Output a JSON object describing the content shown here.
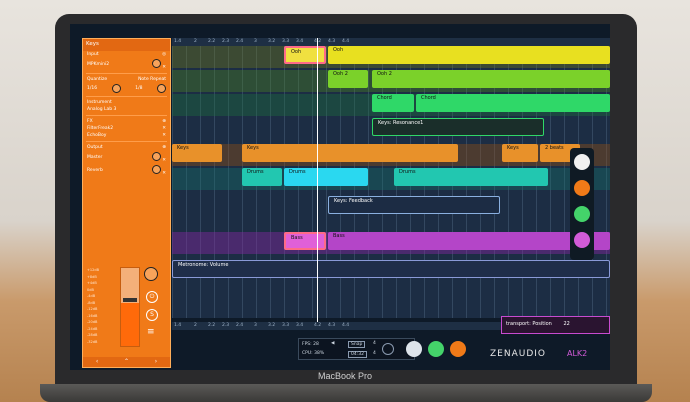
{
  "laptop_brand": "MacBook Pro",
  "panel": {
    "title": "Keys",
    "input_label": "Input",
    "input_device": "MPKmini2",
    "quantize_label": "Quantize",
    "note_repeat_label": "Note Repeat",
    "quantize_value": "1/16",
    "note_repeat_value": "1/8",
    "instrument_label": "Instrument",
    "instrument_value": "Analog Lab 3",
    "fx_label": "FX",
    "fx_items": [
      "FilterFreak2",
      "EchoBoy"
    ],
    "output_label": "Output",
    "output_items": [
      "Master",
      "Reverb"
    ],
    "db_scale": [
      "+12dB",
      "+8dB",
      "+4dB",
      "0dB",
      "-4dB",
      "-8dB",
      "-12dB",
      "-16dB",
      "-20dB",
      "-24dB",
      "-28dB",
      "-32dB"
    ],
    "meter_level": 0.55,
    "btn_power": "⏻",
    "btn_solo": "S",
    "btn_menu": "≡"
  },
  "ruler_labels": [
    "1.4",
    "2",
    "2.2",
    "2.3",
    "2.4",
    "3",
    "3.2",
    "3.3",
    "3.4",
    "4.2",
    "4.3",
    "4.4"
  ],
  "clips": {
    "ooh_a": "Ooh",
    "ooh_b": "Ooh",
    "ooh2_a": "Ooh 2",
    "ooh2_b": "Ooh 2",
    "chord_a": "Chord",
    "chord_b": "Chord",
    "resonance": "Keys: Resonance1",
    "keys_a": "Keys",
    "keys_b": "Keys",
    "keys_c": "Keys",
    "beats": "2 beats",
    "drums_a": "Drums",
    "drums_b": "Drums",
    "drums_c": "Drums",
    "feedback": "Keys: Feedback",
    "bass_a": "Bass",
    "bass_b": "Bass",
    "metronome": "Metronome: Volume"
  },
  "transport": {
    "fps": "FPS: 28",
    "cpu": "CPU: 38%",
    "snap": "Snap",
    "time_sig_top": "4",
    "time_sig_bottom": "4",
    "time": "04:32",
    "position_label": "transport: Position",
    "position_value": "22"
  },
  "logo": "ZENAUDIO",
  "logo_suffix": "ALK2",
  "colors": {
    "accent_orange": "#f07a18",
    "ooh_yellow": "#e8e020",
    "ooh2_green": "#7bd12a",
    "chord_green": "#2fd868",
    "drums_teal": "#22c7b0",
    "bass_pink": "#e060d8",
    "keys_orange": "#e8912a"
  }
}
